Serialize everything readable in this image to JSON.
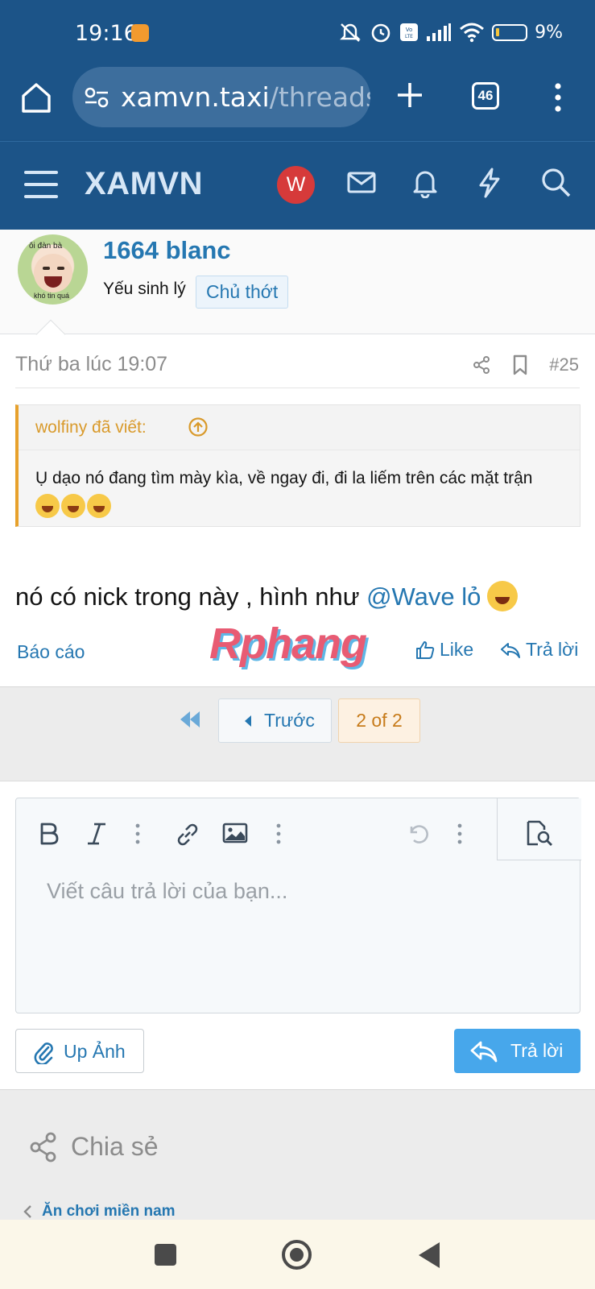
{
  "status_bar": {
    "time": "19:16",
    "battery": "9%"
  },
  "browser": {
    "url_host": "xamvn.taxi",
    "url_path": "/threads",
    "tab_count": "46"
  },
  "site": {
    "logo": "XAMVN",
    "avatar_letter": "W"
  },
  "post_user": {
    "username": "1664 blanc",
    "user_title": "Yếu sinh lý",
    "badge": "Chủ thớt",
    "avatar_caption_top": "ôi đàn bà",
    "avatar_caption_bottom": "khó tin quá"
  },
  "post": {
    "timestamp": "Thứ ba lúc 19:07",
    "number": "#25",
    "quote_author": "wolfiny đã viết:",
    "quote_text": "Ụ dạo nó đang tìm mày kìa, về ngay đi, đi la liếm trên các mặt trận",
    "body_text": "nó có nick trong này , hình như ",
    "mention": "@Wave lỏ",
    "report": "Báo cáo",
    "like": "Like",
    "reply": "Trả lời"
  },
  "watermark": "Rphang",
  "pagination": {
    "prev": "Trước",
    "current": "2 of 2"
  },
  "editor": {
    "placeholder": "Viết câu trả lời của bạn..."
  },
  "actions": {
    "upload": "Up Ảnh",
    "submit": "Trả lời"
  },
  "footer": {
    "share": "Chia sẻ",
    "breadcrumb": "Ăn chơi miền nam"
  },
  "colors": {
    "header_blue": "#1c5488",
    "link_blue": "#2577b1",
    "quote_orange": "#e7a12c",
    "button_blue": "#47a7eb"
  }
}
